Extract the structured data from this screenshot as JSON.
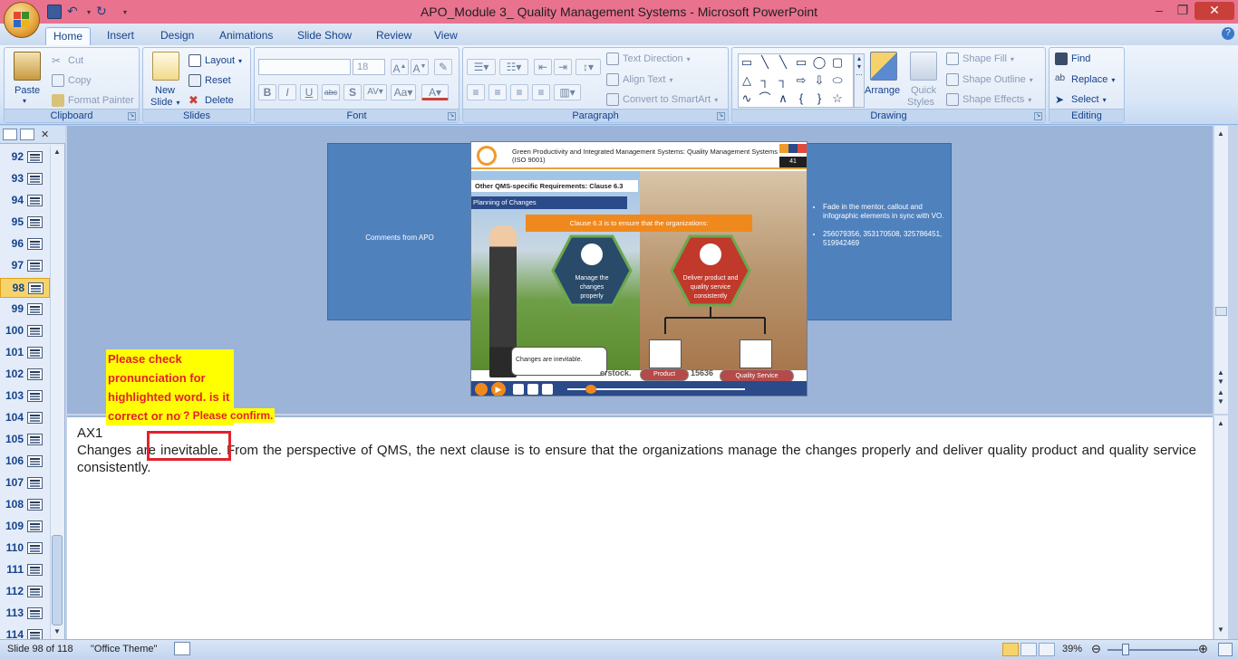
{
  "window": {
    "title": "APO_Module 3_ Quality Management Systems - Microsoft PowerPoint",
    "minimize": "–",
    "restore": "❐",
    "close": "✕"
  },
  "tabs": [
    {
      "label": "Home",
      "active": true
    },
    {
      "label": "Insert"
    },
    {
      "label": "Design"
    },
    {
      "label": "Animations"
    },
    {
      "label": "Slide Show"
    },
    {
      "label": "Review"
    },
    {
      "label": "View"
    }
  ],
  "ribbon": {
    "clipboard": {
      "label": "Clipboard",
      "paste": "Paste",
      "cut": "Cut",
      "copy": "Copy",
      "format_painter": "Format Painter"
    },
    "slides": {
      "label": "Slides",
      "new_slide": "New",
      "new_slide_2": "Slide",
      "layout": "Layout",
      "reset": "Reset",
      "delete": "Delete"
    },
    "font": {
      "label": "Font",
      "font_name": "",
      "font_size": "18"
    },
    "paragraph": {
      "label": "Paragraph",
      "text_direction": "Text Direction",
      "align_text": "Align Text",
      "convert_smartart": "Convert to SmartArt"
    },
    "drawing": {
      "label": "Drawing",
      "arrange": "Arrange",
      "quick_styles": "Quick",
      "quick_styles_2": "Styles",
      "shape_fill": "Shape Fill",
      "shape_outline": "Shape Outline",
      "shape_effects": "Shape Effects"
    },
    "editing": {
      "label": "Editing",
      "find": "Find",
      "replace": "Replace",
      "select": "Select"
    }
  },
  "slides_panel": {
    "items": [
      {
        "num": "92"
      },
      {
        "num": "93"
      },
      {
        "num": "94"
      },
      {
        "num": "95"
      },
      {
        "num": "96"
      },
      {
        "num": "97"
      },
      {
        "num": "98",
        "selected": true
      },
      {
        "num": "99"
      },
      {
        "num": "100"
      },
      {
        "num": "101"
      },
      {
        "num": "102"
      },
      {
        "num": "103"
      },
      {
        "num": "104"
      },
      {
        "num": "105"
      },
      {
        "num": "106"
      },
      {
        "num": "107"
      },
      {
        "num": "108"
      },
      {
        "num": "109"
      },
      {
        "num": "110"
      },
      {
        "num": "111"
      },
      {
        "num": "112"
      },
      {
        "num": "113"
      },
      {
        "num": "114"
      }
    ]
  },
  "slide": {
    "left_comment": "Comments from APO",
    "right_bullets": [
      "Fade in the mentor, callout and infographic elements in sync with VO.",
      "256079356, 353170508, 325786451, 519942469"
    ],
    "header_title": "Green Productivity and Integrated Management Systems: Quality Management Systems (ISO 9001)",
    "page_number": "41",
    "section_title": "Other QMS-specific Requirements: Clause 6.3",
    "subsection": "Planning of Changes",
    "banner": "Clause 6.3 is to ensure that the organizations:",
    "hex_left": "Manage the changes properly",
    "hex_right": "Deliver product and quality service consistently",
    "callout": "Changes are inevitable.",
    "watermark": "erstock.",
    "watermark_2": "15636",
    "pill_product": "Product",
    "pill_quality": "Quality Service"
  },
  "notes": {
    "line1": "AX1",
    "body_before": "Changes ar",
    "body_highlight": "e inevitable.",
    "body_after": " From the perspective of QMS, the next clause is to ensure that the organizations manage the changes properly and deliver quality product and quality service consistently."
  },
  "comment": {
    "text": "Please check pronunciation for highlighted word. is it correct or not",
    "text2": "? Please confirm."
  },
  "statusbar": {
    "slide_info": "Slide 98 of 118",
    "theme": "\"Office Theme\"",
    "zoom": "39%",
    "zoom_level": 0.39
  }
}
